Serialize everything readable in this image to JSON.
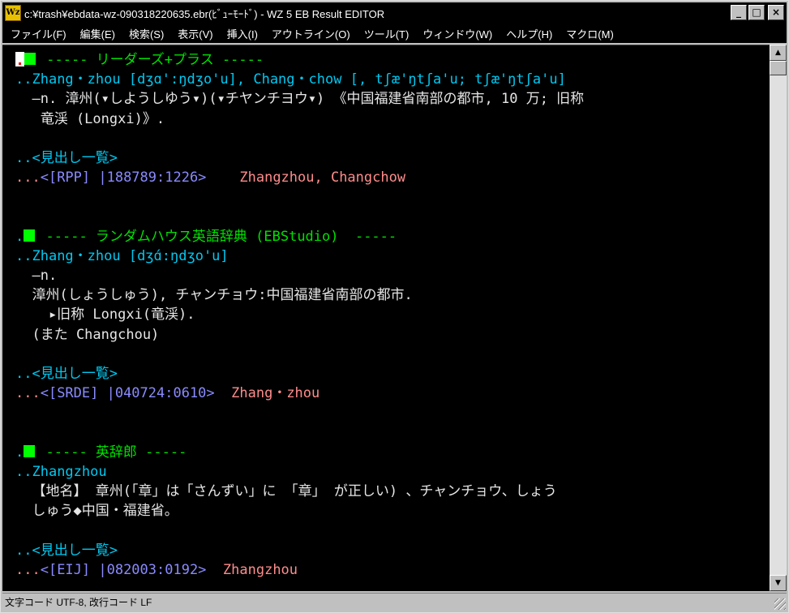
{
  "window": {
    "title": "c:¥trash¥ebdata-wz-090318220635.ebr(ﾋﾞｭｰﾓｰﾄﾞ) - WZ 5 EB Result EDITOR",
    "app_icon_text": "Wz",
    "buttons": {
      "minimize": "_",
      "maximize": "□",
      "close": "×"
    }
  },
  "menu": [
    "ファイル(F)",
    "編集(E)",
    "検索(S)",
    "表示(V)",
    "挿入(I)",
    "アウトライン(O)",
    "ツール(T)",
    "ウィンドウ(W)",
    "ヘルプ(H)",
    "マクロ(M)"
  ],
  "content": {
    "l1_title": "----- リーダーズ+プラス -----",
    "l2_dots": "..",
    "l2_text": "Zhang・zhou [dʒɑ':ŋdʒo'u], Chang・chow [, tʃæ'ŋtʃa'u; tʃæ'ŋtʃa'u]",
    "l3_text": "  ―n. 漳州(▾しようしゆう▾)(▾チヤンチヨウ▾) 《中国福建省南部の都市, 10 万; 旧称",
    "l4_text": "   竜渓 (Longxi)》.",
    "l6_dots": "..",
    "l6_text": "<見出し一覧>",
    "l7_dots": "...",
    "l7_ref": "<[RPP] |188789:1226>",
    "l7_word": "Zhangzhou, Changchow",
    "l10_dot": ".",
    "l10_title": "----- ランダムハウス英語辞典 (EBStudio)  -----",
    "l11_dots": "..",
    "l11_text": "Zhang・zhou [dʒɑ́:ŋdʒo'u]",
    "l12_text": "  ―n.",
    "l13_text": "  漳州(しょうしゅう), チャンチョウ:中国福建省南部の都市.",
    "l14_text": "    ▸旧称 Longxi(竜渓).",
    "l15_text": "  (また Changchou)",
    "l17_dots": "..",
    "l17_text": "<見出し一覧>",
    "l18_dots": "...",
    "l18_ref": "<[SRDE] |040724:0610>",
    "l18_word": "Zhang・zhou",
    "l21_dot": ".",
    "l21_title": "----- 英辞郎 -----",
    "l22_dots": "..",
    "l22_text": "Zhangzhou",
    "l23_text": "  【地名】 章州(「章」は「さんずい」に 「章」 が正しい) 、チャンチョウ、しょう",
    "l24_text": "  しゅう◆中国・福建省。",
    "l26_dots": "..",
    "l26_text": "<見出し一覧>",
    "l27_dots": "...",
    "l27_ref": "<[EIJ] |082003:0192>",
    "l27_word": "Zhangzhou"
  },
  "status": {
    "text": "文字コード UTF-8, 改行コード LF"
  },
  "colors": {
    "background": "#000000",
    "text": "#e6e6e6",
    "heading_green": "#00e000",
    "headword_cyan": "#00c8f0",
    "ref_blue": "#8a8aff",
    "word_pink": "#ff8c8c"
  }
}
